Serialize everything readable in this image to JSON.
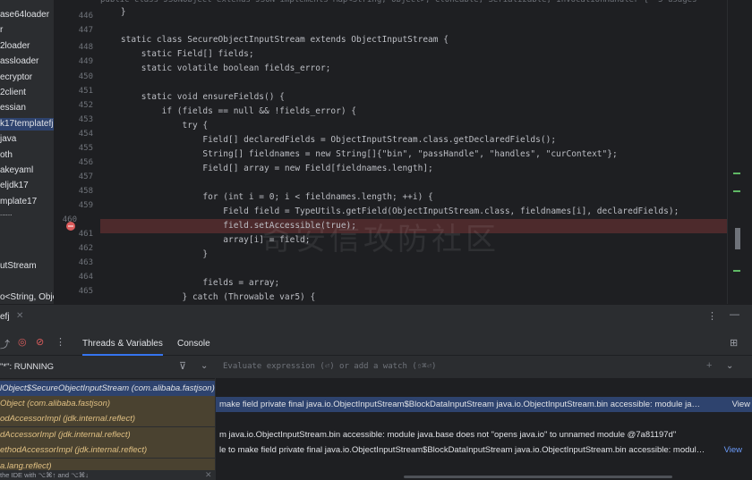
{
  "sidebar": {
    "items": [
      "ase64loader",
      "r",
      "2loader",
      "assloader",
      "ecryptor",
      "2client",
      "essian",
      "k17templatefj",
      "java",
      "oth",
      "akeyaml",
      "eljdk17",
      "mplate17",
      "......",
      "",
      "",
      "utStream",
      "",
      "o<String, Obje"
    ]
  },
  "editor": {
    "top_line": "public class JSONObject extends JSON implements Map<String, Object>, Cloneable, Serializable, InvocationHandler {  5 usages",
    "line_numbers": [
      "446",
      "447",
      "448",
      "449",
      "450",
      "451",
      "452",
      "453",
      "454",
      "455",
      "456",
      "457",
      "458",
      "459",
      "460",
      "461",
      "462",
      "463",
      "464",
      "465"
    ],
    "lines": [
      "    }",
      "",
      "    static class SecureObjectInputStream extends ObjectInputStream {",
      "        static Field[] fields;",
      "        static volatile boolean fields_error;",
      "",
      "        static void ensureFields() {",
      "            if (fields == null && !fields_error) {",
      "                try {",
      "                    Field[] declaredFields = ObjectInputStream.class.getDeclaredFields();",
      "                    String[] fieldnames = new String[]{\"bin\", \"passHandle\", \"handles\", \"curContext\"};",
      "                    Field[] array = new Field[fieldnames.length];",
      "",
      "                    for (int i = 0; i < fieldnames.length; ++i) {",
      "                        Field field = TypeUtils.getField(ObjectInputStream.class, fieldnames[i], declaredFields);",
      "                        field.setAccessible(true);",
      "                        array[i] = field;",
      "                    }",
      "",
      "                    fields = array;",
      "                } catch (Throwable var5) {"
    ],
    "watermark": "奇安信攻防社区"
  },
  "bottom": {
    "tab_name": "efj",
    "tabs": [
      "Threads & Variables",
      "Console"
    ],
    "thread_status": "\"*\": RUNNING",
    "eval_placeholder": "Evaluate expression (⏎) or add a watch (⇧⌘⏎)",
    "frames": [
      "lObject$SecureObjectInputStream (com.alibaba.fastjson)",
      "Object (com.alibaba.fastjson)",
      "odAccessorImpl (jdk.internal.reflect)",
      "dAccessorImpl (jdk.internal.reflect)",
      "ethodAccessorImpl (jdk.internal.reflect)",
      "a.lang.reflect)"
    ],
    "frames_hint": "the IDE with ⌥⌘↑ and ⌥⌘↓",
    "vars": [
      {
        "text": "make field private final java.io.ObjectInputStream$BlockDataInputStream java.io.ObjectInputStream.bin accessible: module ja…",
        "link": "View"
      },
      {
        "text": "m java.io.ObjectInputStream.bin accessible: module java.base does not \"opens java.io\" to unnamed module @7a81197d\"",
        "link": ""
      },
      {
        "text": "le to make field private final java.io.ObjectInputStream$BlockDataInputStream java.io.ObjectInputStream.bin accessible: modul…",
        "link": "View"
      }
    ]
  }
}
